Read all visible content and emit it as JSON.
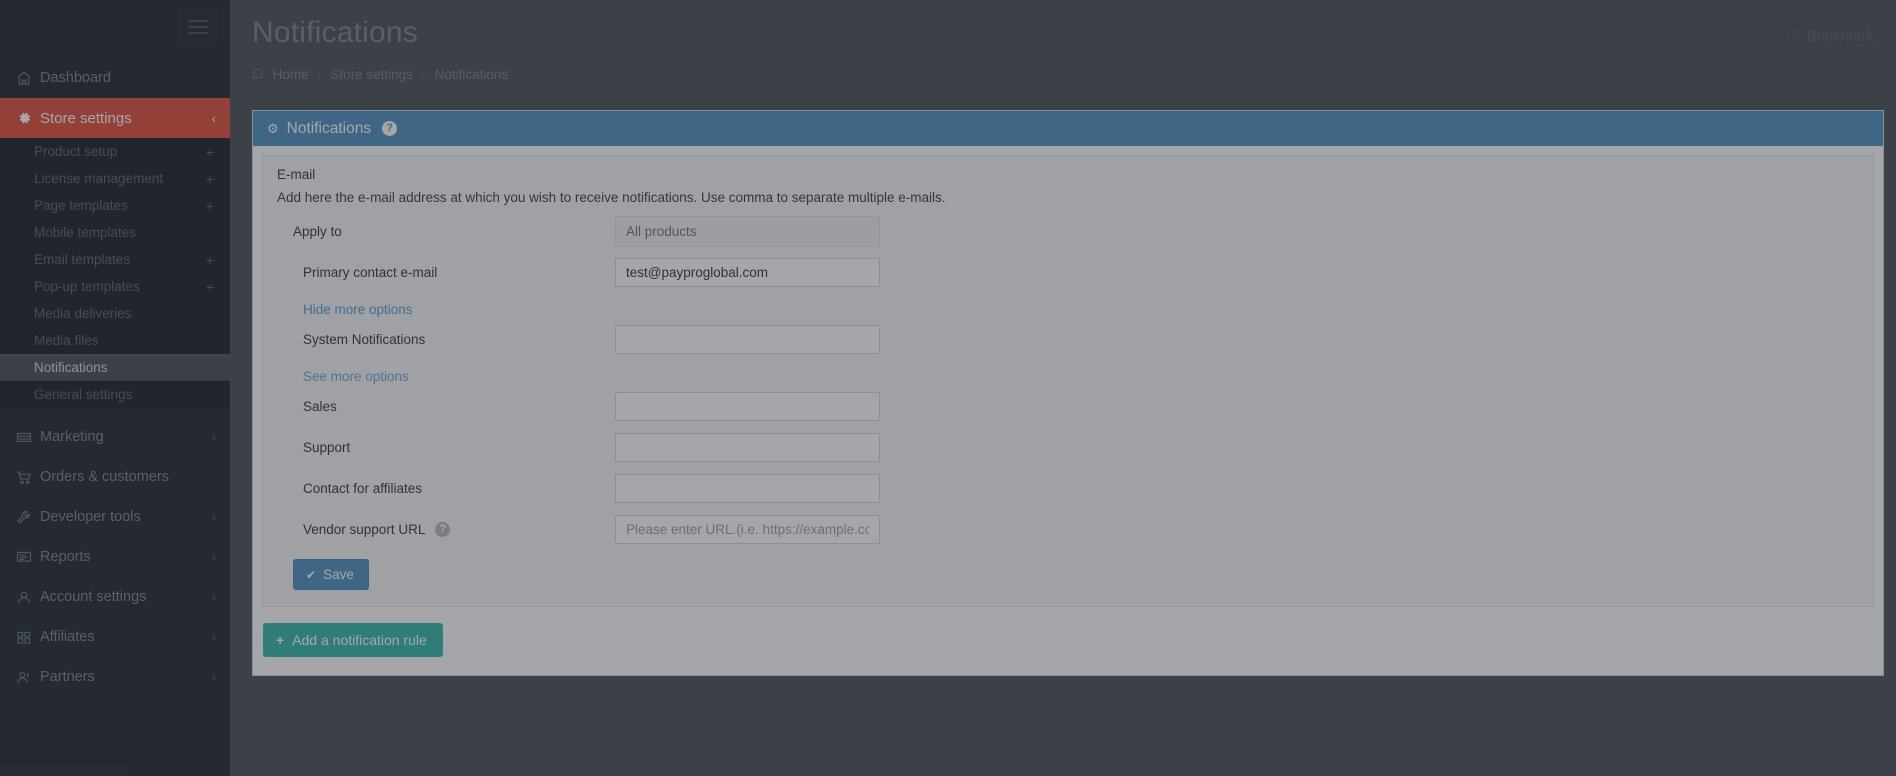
{
  "sidebar": {
    "menu_icon": "hamburger-icon",
    "items": [
      {
        "label": "Dashboard",
        "icon": "home-icon",
        "active": false,
        "caret": ""
      },
      {
        "label": "Store settings",
        "icon": "gear-icon",
        "active": true,
        "caret": "‹"
      }
    ],
    "sub_items": [
      {
        "label": "Product setup",
        "plus": "+",
        "current": false
      },
      {
        "label": "License management",
        "plus": "+",
        "current": false
      },
      {
        "label": "Page templates",
        "plus": "+",
        "current": false
      },
      {
        "label": "Mobile templates",
        "plus": "",
        "current": false
      },
      {
        "label": "Email templates",
        "plus": "+",
        "current": false
      },
      {
        "label": "Pop-up templates",
        "plus": "+",
        "current": false
      },
      {
        "label": "Media deliveries",
        "plus": "",
        "current": false
      },
      {
        "label": "Media files",
        "plus": "",
        "current": false
      },
      {
        "label": "Notifications",
        "plus": "",
        "current": true
      },
      {
        "label": "General settings",
        "plus": "",
        "current": false
      }
    ],
    "bottom_items": [
      {
        "label": "Marketing",
        "icon": "megaphone-icon",
        "caret": "‹"
      },
      {
        "label": "Orders & customers",
        "icon": "cart-icon",
        "caret": ""
      },
      {
        "label": "Developer tools",
        "icon": "wrench-icon",
        "caret": "‹"
      },
      {
        "label": "Reports",
        "icon": "report-icon",
        "caret": "‹"
      },
      {
        "label": "Account settings",
        "icon": "user-icon",
        "caret": "‹"
      },
      {
        "label": "Affiliates",
        "icon": "grid-icon",
        "caret": "‹"
      },
      {
        "label": "Partners",
        "icon": "users-icon",
        "caret": "‹"
      }
    ]
  },
  "header": {
    "title": "Notifications",
    "bookmark_label": "Bookmark",
    "bookmark_icon": "heart-icon"
  },
  "breadcrumb": {
    "home_icon": "home-icon",
    "items": [
      "Home",
      "Store settings",
      "Notifications"
    ],
    "separator": "›"
  },
  "panel": {
    "gear_icon": "gear-icon",
    "title": "Notifications",
    "help_icon": "question-mark-icon",
    "help_glyph": "?"
  },
  "form": {
    "section_title": "E-mail",
    "section_desc": "Add here the e-mail address at which you wish to receive notifications. Use comma to separate multiple e-mails.",
    "apply_to": {
      "label": "Apply to",
      "value": "All products"
    },
    "primary_email": {
      "label": "Primary contact e-mail",
      "value": "test@payproglobal.com"
    },
    "hide_more_options": "Hide more options",
    "system_notifications": {
      "label": "System Notifications",
      "value": ""
    },
    "see_more_options": "See more options",
    "sales": {
      "label": "Sales",
      "value": ""
    },
    "support": {
      "label": "Support",
      "value": ""
    },
    "contact_affiliates": {
      "label": "Contact for affiliates",
      "value": ""
    },
    "vendor_support_url": {
      "label": "Vendor support URL",
      "value": "",
      "placeholder": "Please enter URL.(i.e. https://example.com)",
      "help_glyph": "?"
    },
    "save_button": {
      "label": "Save",
      "icon": "check-icon",
      "glyph": "✔"
    }
  },
  "footer": {
    "add_rule_button": {
      "label": "Add a notification rule",
      "icon": "plus-icon",
      "glyph": "+"
    }
  },
  "colors": {
    "sidebar_bg": "#222a2f",
    "sidebar_sub_bg": "#1d2429",
    "accent_red": "#e0503d",
    "panel_blue": "#5191c3",
    "teal": "#35b9a8",
    "page_bg": "#4b5057"
  }
}
